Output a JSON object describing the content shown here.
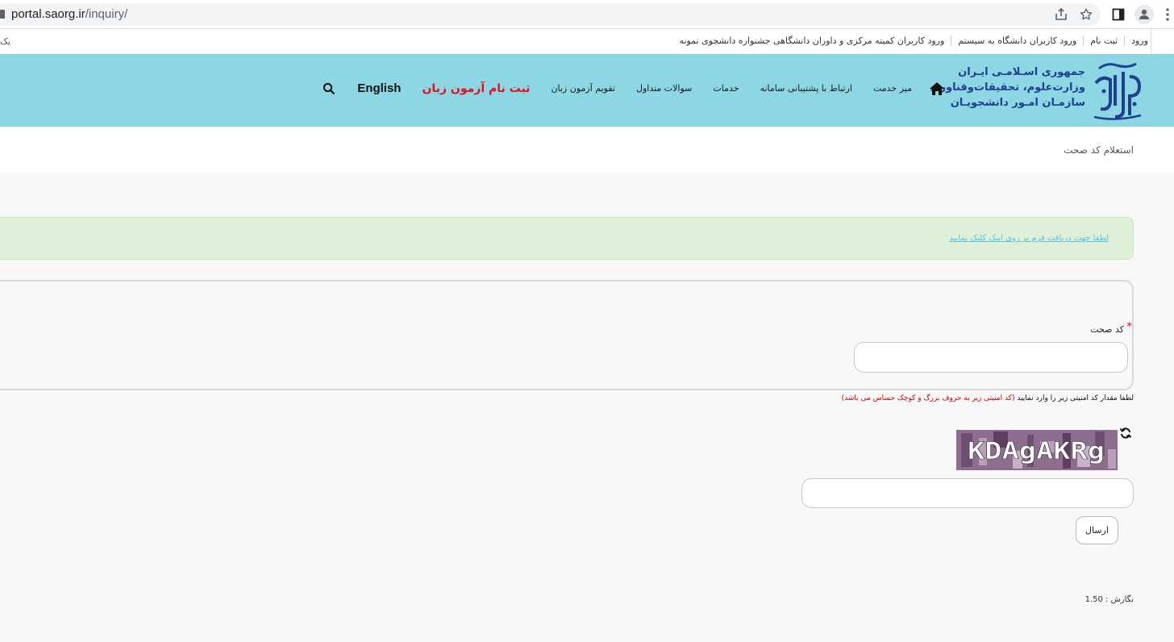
{
  "browser": {
    "url_host": "portal.saorg.ir",
    "url_path": "/inquiry/"
  },
  "toplinks": {
    "items": [
      "ورود",
      "ثبت نام",
      "ورود کاربران دانشگاه به سیستم",
      "ورود کاربران کمیته مرکزی و داوران دانشگاهی جشنواره دانشجوی نمونه"
    ],
    "edge_text": "یک"
  },
  "logo": {
    "line1": "جمهوری اسـلامـی ایـران",
    "line2": "وزارت‌علوم، تحقیقات‌وفناوری",
    "line3": "سازمـان امـور دانشجویـان",
    "emblem_text": "سازمان امور دانشجویان"
  },
  "nav": {
    "items": [
      "میز خدمت",
      "ارتباط با پشتیبانی سامانه",
      "خدمات",
      "سوالات متداول",
      "تقویم آزمون زبان"
    ],
    "highlight": "ثبت نام آزمون زبان",
    "english": "English"
  },
  "breadcrumb": "استعلام کد صحت",
  "alert": {
    "link_text": "لطفا جهت دریافت فرم بر روی اینک کلیک نمایید"
  },
  "form": {
    "code_label": "کد صحت",
    "required_mark": "*",
    "code_value": "",
    "captcha_hint": "لطفا مقدار کد امنیتی زیر را وارد نمایید",
    "captcha_note": "(کد امنیتی زیر به حروف بزرگ و کوچک حساس می باشد)",
    "captcha_text": "KDAgAKRg",
    "captcha_value": "",
    "submit_label": "ارسال"
  },
  "version": "نگارش : 1.50",
  "colors": {
    "header_bg": "#8dd6e3",
    "highlight": "#e2101e",
    "logo_text": "#1f3f8f",
    "alert_bg": "#dff0d8",
    "alert_link": "#5bc0de"
  }
}
